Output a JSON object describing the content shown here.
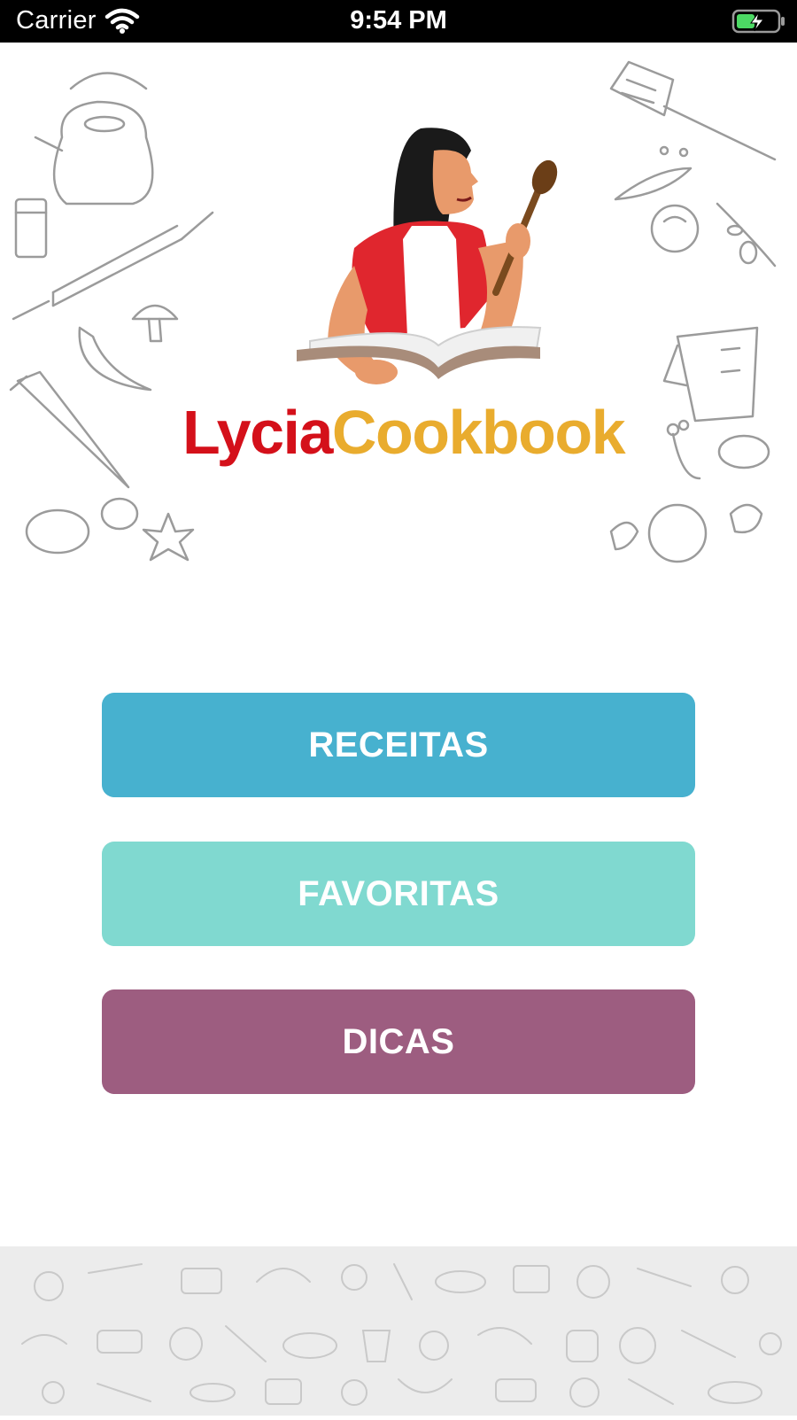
{
  "status_bar": {
    "carrier": "Carrier",
    "time": "9:54 PM",
    "battery_icon": "battery-charging-icon",
    "wifi_icon": "wifi-icon"
  },
  "brand": {
    "part1": "Lycia",
    "part2": "Cookbook",
    "part1_color": "#d4101a",
    "part2_color": "#e9ac2e"
  },
  "menu": {
    "receitas_label": "RECEITAS",
    "favoritas_label": "FAVORITAS",
    "dicas_label": "DICAS",
    "receitas_color": "#47b1cf",
    "favoritas_color": "#80d9d0",
    "dicas_color": "#9d5d80"
  },
  "decorations": {
    "top_left": [
      "kettle-icon",
      "spice-jar-icon",
      "rolling-pin-icon",
      "chili-pepper-icon",
      "mushroom-icon",
      "piping-bag-icon",
      "potato-icon",
      "star-anise-icon"
    ],
    "top_right": [
      "spatula-icon",
      "peas-icon",
      "tomato-icon",
      "olive-branch-icon",
      "measuring-cup-icon",
      "herb-icon",
      "lemon-icon",
      "garlic-icon"
    ],
    "footer": "kitchen-pattern"
  }
}
